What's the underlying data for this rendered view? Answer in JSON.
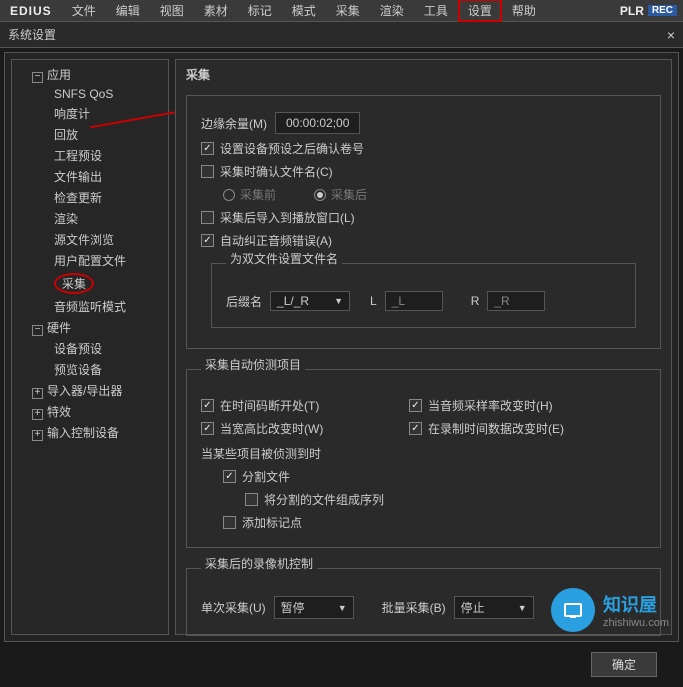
{
  "app": {
    "logo": "EDIUS",
    "plr": "PLR",
    "rec": "REC"
  },
  "menu": [
    "文件",
    "编辑",
    "视图",
    "素材",
    "标记",
    "模式",
    "采集",
    "渲染",
    "工具",
    "设置",
    "帮助"
  ],
  "dialog_title": "系统设置",
  "tree": {
    "app": "应用",
    "app_children": [
      "SNFS QoS",
      "响度计",
      "回放",
      "工程预设",
      "文件输出",
      "检查更新",
      "渲染",
      "源文件浏览",
      "用户配置文件",
      "采集",
      "音频监听模式"
    ],
    "hardware": "硬件",
    "hardware_children": [
      "设备预设",
      "预览设备"
    ],
    "io": "导入器/导出器",
    "fx": "特效",
    "input": "输入控制设备"
  },
  "panel": {
    "title": "采集",
    "margin_label": "边缘余量(M)",
    "margin_value": "00:00:02;00",
    "confirm_reel": "设置设备预设之后确认卷号",
    "confirm_name": "采集时确认文件名(C)",
    "before": "采集前",
    "after": "采集后",
    "import_window": "采集后导入到播放窗口(L)",
    "auto_audio": "自动纠正音频错误(A)",
    "dual_fieldset": "为双文件设置文件名",
    "suffix_label": "后缀名",
    "suffix_value": "_L/_R",
    "l_label": "L",
    "l_value": "_L",
    "r_label": "R",
    "r_value": "_R",
    "autodetect_fieldset": "采集自动侦测项目",
    "at_tc_break": "在时间码断开处(T)",
    "at_aspect": "当宽高比改变时(W)",
    "at_audio_rate": "当音频采样率改变时(H)",
    "at_rec_num": "在录制时间数据改变时(E)",
    "when_detected": "当某些项目被侦测到时",
    "split_file": "分割文件",
    "make_seq": "将分割的文件组成序列",
    "add_marker": "添加标记点",
    "vcr_fieldset": "采集后的录像机控制",
    "single_label": "单次采集(U)",
    "single_value": "暂停",
    "batch_label": "批量采集(B)",
    "batch_value": "停止",
    "ok": "确定"
  },
  "watermark": {
    "title": "知识屋",
    "url": "zhishiwu.com"
  }
}
